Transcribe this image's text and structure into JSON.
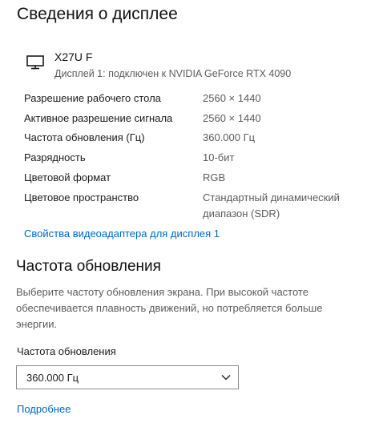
{
  "header": {
    "title": "Сведения о дисплее"
  },
  "monitor": {
    "icon": "monitor-icon",
    "name": "X27U F",
    "subtitle": "Дисплей 1: подключен к NVIDIA GeForce RTX 4090"
  },
  "info": {
    "rows": [
      {
        "label": "Разрешение рабочего стола",
        "value": "2560 × 1440"
      },
      {
        "label": "Активное разрешение сигнала",
        "value": "2560 × 1440"
      },
      {
        "label": "Частота обновления (Гц)",
        "value": "360.000 Гц"
      },
      {
        "label": "Разрядность",
        "value": "10-бит"
      },
      {
        "label": "Цветовой формат",
        "value": "RGB"
      },
      {
        "label": "Цветовое пространство",
        "value_line1": "Стандартный динамический",
        "value_line2": "диапазон (SDR)"
      }
    ]
  },
  "adapter_link": "Свойства видеоадаптера для дисплея 1",
  "refresh": {
    "title": "Частота обновления",
    "description": "Выберите частоту обновления экрана. При высокой частоте обеспечивается плавность движений, но потребляется больше энергии.",
    "field_label": "Частота обновления",
    "selected": "360.000 Гц",
    "more_link": "Подробнее"
  },
  "colors": {
    "link": "#0067c0",
    "secondary_text": "#5c5c5c"
  }
}
